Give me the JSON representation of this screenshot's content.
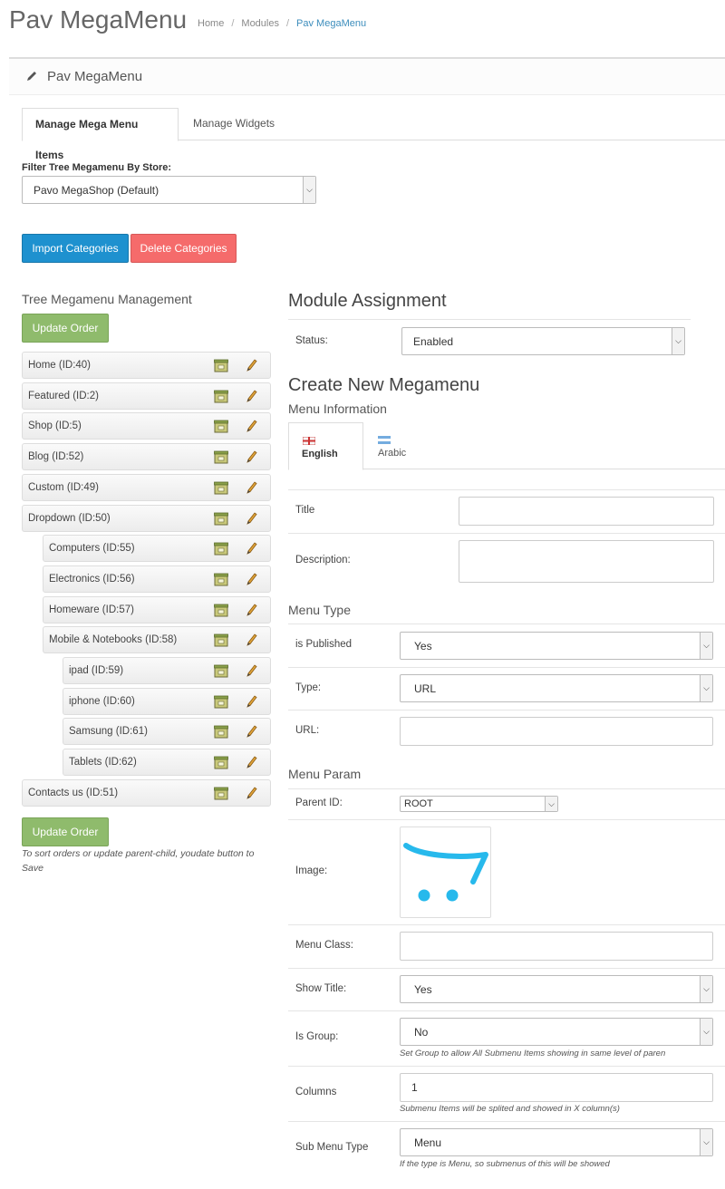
{
  "header": {
    "title": "Pav MegaMenu",
    "breadcrumb": [
      "Home",
      "Modules",
      "Pav MegaMenu"
    ],
    "breadcrumb_sep": "/"
  },
  "panel": {
    "title": "Pav MegaMenu"
  },
  "tabs": [
    "Manage Mega Menu Items",
    "Manage Widgets"
  ],
  "filter": {
    "label": "Filter Tree Megamenu By Store:",
    "value": "Pavo MegaShop (Default)"
  },
  "buttons": {
    "import": "Import Categories",
    "delete": "Delete Categories",
    "update_order": "Update Order"
  },
  "tree": {
    "title": "Tree Megamenu Management",
    "items": [
      {
        "label": "Home (ID:40)",
        "level": 0
      },
      {
        "label": "Featured (ID:2)",
        "level": 0
      },
      {
        "label": "Shop (ID:5)",
        "level": 0
      },
      {
        "label": "Blog (ID:52)",
        "level": 0
      },
      {
        "label": "Custom (ID:49)",
        "level": 0
      },
      {
        "label": "Dropdown (ID:50)",
        "level": 0
      },
      {
        "label": "Computers (ID:55)",
        "level": 1
      },
      {
        "label": "Electronics (ID:56)",
        "level": 1
      },
      {
        "label": "Homeware (ID:57)",
        "level": 1
      },
      {
        "label": "Mobile & Notebooks (ID:58)",
        "level": 1
      },
      {
        "label": "ipad (ID:59)",
        "level": 2
      },
      {
        "label": "iphone (ID:60)",
        "level": 2
      },
      {
        "label": "Samsung (ID:61)",
        "level": 2
      },
      {
        "label": "Tablets (ID:62)",
        "level": 2
      },
      {
        "label": "Contacts us (ID:51)",
        "level": 0
      }
    ],
    "note": "To sort orders or update parent-child, youdate button to Save"
  },
  "module_assignment": {
    "title": "Module Assignment",
    "status_label": "Status:",
    "status_value": "Enabled"
  },
  "create": {
    "title": "Create New Megamenu",
    "menu_info": "Menu Information",
    "languages": [
      "English",
      "Arabic"
    ],
    "title_label": "Title",
    "description_label": "Description:",
    "menu_type_heading": "Menu Type",
    "published_label": "is Published",
    "published_value": "Yes",
    "type_label": "Type:",
    "type_value": "URL",
    "url_label": "URL:",
    "menu_param_heading": "Menu Param",
    "parent_label": "Parent ID:",
    "parent_value": "ROOT",
    "image_label": "Image:",
    "class_label": "Menu Class:",
    "show_title_label": "Show Title:",
    "show_title_value": "Yes",
    "is_group_label": "Is Group:",
    "is_group_value": "No",
    "is_group_help": "Set Group to allow All Submenu Items showing in same level of paren",
    "columns_label": "Columns",
    "columns_value": "1",
    "columns_help": "Submenu Items will be splited and showed in X column(s)",
    "submenu_type_label": "Sub Menu Type",
    "submenu_type_value": "Menu",
    "submenu_type_help": "If the type is Menu, so submenus of this will be showed"
  },
  "colors": {
    "primary": "#1e91cf",
    "danger": "#f56b6b",
    "success": "#8fbb6c",
    "link": "#3c8dbc"
  }
}
